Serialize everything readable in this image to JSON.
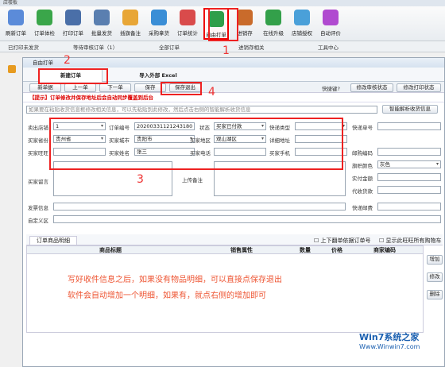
{
  "window_title": "店楼板",
  "toolbar": [
    "刷新订单",
    "订单体检",
    "打印订单",
    "批量发货",
    "插旗备注",
    "采购拿货",
    "订单统计",
    "自由打单",
    "进销存",
    "在线升级",
    "店铺授权",
    "自动评价"
  ],
  "tabs": [
    "已打印未发货",
    "等待审核订单（1）",
    "全部订单",
    "进销存相关",
    "工具中心"
  ],
  "dialog": {
    "title": "自由打单",
    "tab_new": "新建订单",
    "tab_import": "导入外部 Excel",
    "buttons": [
      "新单据",
      "上一单",
      "下一单",
      "保存",
      "保存退出"
    ],
    "quick_edit": "快捷键?",
    "modify_audit": "修改审核状态",
    "modify_print": "修改打印状态",
    "tip": "【提示】订单修改并保存地址后会自动同步覆盖到后台",
    "paste_hint": "如果要在粘贴收货信息框修改相关信息，可以先粘贴到此修改，然后点击右侧的智能解析收货信息",
    "smart_parse": "智能解析收货信息",
    "labels": {
      "shop": "卖出店铺",
      "order_no": "订单编号",
      "status": "状态",
      "express": "快递类型",
      "express_no": "快递单号",
      "province": "买家省份",
      "city": "买家城市",
      "district": "买家地区",
      "address": "详细地址",
      "wangwang": "买家旺旺",
      "name": "买家姓名",
      "phone": "买家电话",
      "mobile": "买家手机",
      "zip": "邮购编码",
      "flag": "旗帜颜色",
      "msg": "买家留言",
      "upload": "上传备注",
      "paid": "实付金额",
      "cod": "代收货款",
      "invoice": "发票信息",
      "custom": "自定义区",
      "express_fee": "快递邮费"
    },
    "values": {
      "shop": "1",
      "order_no": "20200331121243180",
      "status": "买家已付款",
      "province": "贵州省",
      "city": "贵阳市",
      "district": "观山湖区",
      "name": "张三",
      "flag": "灰色"
    },
    "detail_tab": "订单商品明细",
    "check1": "上下翻单依据订单号",
    "check2": "显示此旺旺所有购物车",
    "cols": [
      "商品标题",
      "销售属性",
      "数量",
      "价格",
      "商家编码"
    ],
    "side": [
      "增加",
      "修改",
      "删除"
    ],
    "note1": "写好收件信息之后，如果没有物品明细，可以直接点保存退出",
    "note2": "软件会自动增加一个明细，如果有，就点右侧的增加即可"
  },
  "annotations": [
    "1",
    "2",
    "3",
    "4"
  ],
  "watermark": {
    "logo": "Win7系统之家",
    "url": "Www.Winwin7.com"
  }
}
